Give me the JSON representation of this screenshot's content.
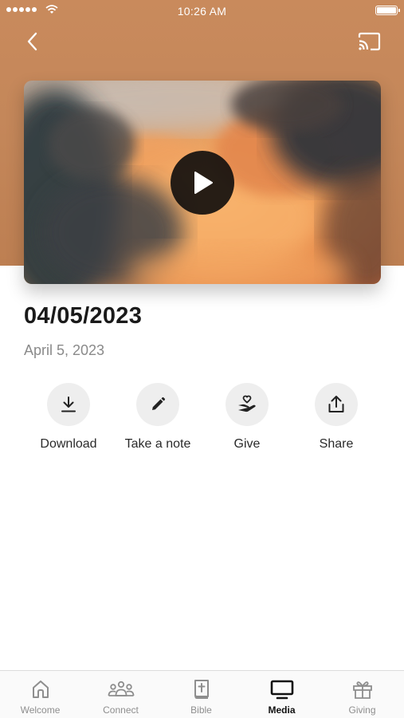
{
  "status_bar": {
    "time": "10:26 AM"
  },
  "nav": {
    "back_icon": "chevron-left-icon",
    "cast_icon": "cast-icon"
  },
  "video": {
    "play_icon": "play-icon"
  },
  "sermon": {
    "title": "04/05/2023",
    "date": "April 5, 2023"
  },
  "actions": [
    {
      "label": "Download",
      "icon": "download-icon"
    },
    {
      "label": "Take a note",
      "icon": "pencil-icon"
    },
    {
      "label": "Give",
      "icon": "heart-hand-icon"
    },
    {
      "label": "Share",
      "icon": "share-icon"
    }
  ],
  "tab_bar": {
    "active": "Media",
    "tabs": [
      {
        "label": "Welcome",
        "icon": "home-icon"
      },
      {
        "label": "Connect",
        "icon": "people-icon"
      },
      {
        "label": "Bible",
        "icon": "bible-icon"
      },
      {
        "label": "Media",
        "icon": "tv-icon"
      },
      {
        "label": "Giving",
        "icon": "gift-icon"
      }
    ]
  },
  "colors": {
    "header_background": "#c4875a",
    "action_circle": "#eeeeee",
    "tab_inactive": "#8e8e8e",
    "tab_active": "#111111"
  }
}
